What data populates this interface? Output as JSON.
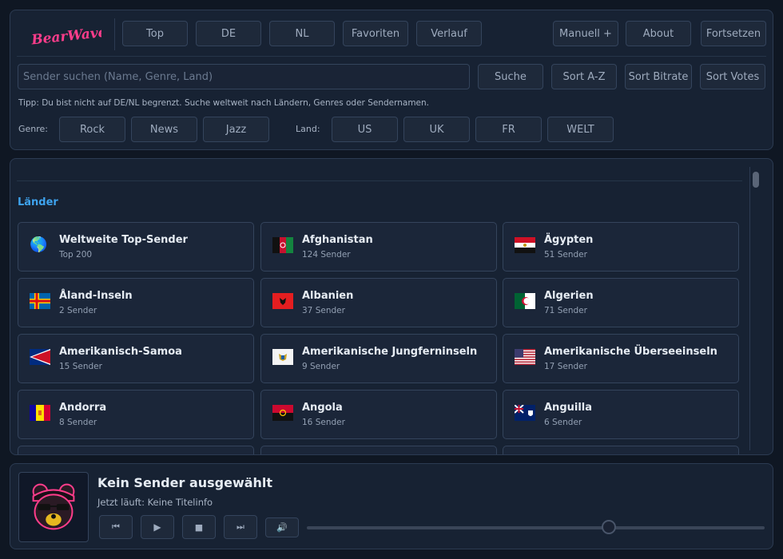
{
  "app": {
    "logo_text": "BearWave"
  },
  "nav": {
    "left": [
      "Top",
      "DE",
      "NL",
      "Favoriten",
      "Verlauf"
    ],
    "right": [
      "Manuell +",
      "About",
      "Fortsetzen"
    ]
  },
  "search": {
    "placeholder": "Sender suchen (Name, Genre, Land)",
    "value": "",
    "search_label": "Suche",
    "sort_az": "Sort A-Z",
    "sort_bitrate": "Sort Bitrate",
    "sort_votes": "Sort Votes"
  },
  "tip": "Tipp: Du bist nicht auf DE/NL begrenzt. Suche weltweit nach Ländern, Genres oder Sendernamen.",
  "genre": {
    "label": "Genre:",
    "items": [
      "Rock",
      "News",
      "Jazz"
    ]
  },
  "country": {
    "label": "Land:",
    "items": [
      "US",
      "UK",
      "FR",
      "WELT"
    ]
  },
  "list": {
    "section_title": "Länder",
    "cards": [
      {
        "flag": "globe",
        "name": "Weltweite Top-Sender",
        "count": "Top 200"
      },
      {
        "flag": "af",
        "name": "Afghanistan",
        "count": "124 Sender"
      },
      {
        "flag": "eg",
        "name": "Ägypten",
        "count": "51 Sender"
      },
      {
        "flag": "ax",
        "name": "Åland-Inseln",
        "count": "2 Sender"
      },
      {
        "flag": "al",
        "name": "Albanien",
        "count": "37 Sender"
      },
      {
        "flag": "dz",
        "name": "Algerien",
        "count": "71 Sender"
      },
      {
        "flag": "as",
        "name": "Amerikanisch-Samoa",
        "count": "15 Sender"
      },
      {
        "flag": "vi",
        "name": "Amerikanische Jungferninseln",
        "count": "9 Sender"
      },
      {
        "flag": "um",
        "name": "Amerikanische Überseeinseln",
        "count": "17 Sender"
      },
      {
        "flag": "ad",
        "name": "Andorra",
        "count": "8 Sender"
      },
      {
        "flag": "ao",
        "name": "Angola",
        "count": "16 Sender"
      },
      {
        "flag": "ai",
        "name": "Anguilla",
        "count": "6 Sender"
      }
    ]
  },
  "player": {
    "title": "Kein Sender ausgewählt",
    "now_playing": "Jetzt läuft: Keine Titelinfo",
    "controls": [
      {
        "icon": "previous-icon",
        "glyph": "⏮"
      },
      {
        "icon": "play-icon",
        "glyph": "▶"
      },
      {
        "icon": "stop-icon",
        "glyph": "■"
      },
      {
        "icon": "next-icon",
        "glyph": "⏭"
      },
      {
        "icon": "volume-icon",
        "glyph": "🔊"
      }
    ],
    "volume_percent": 66
  },
  "colors": {
    "accent": "#3ea3ee",
    "logo": "#ff3d8b",
    "background": "#0f1723",
    "panel": "#172233"
  }
}
